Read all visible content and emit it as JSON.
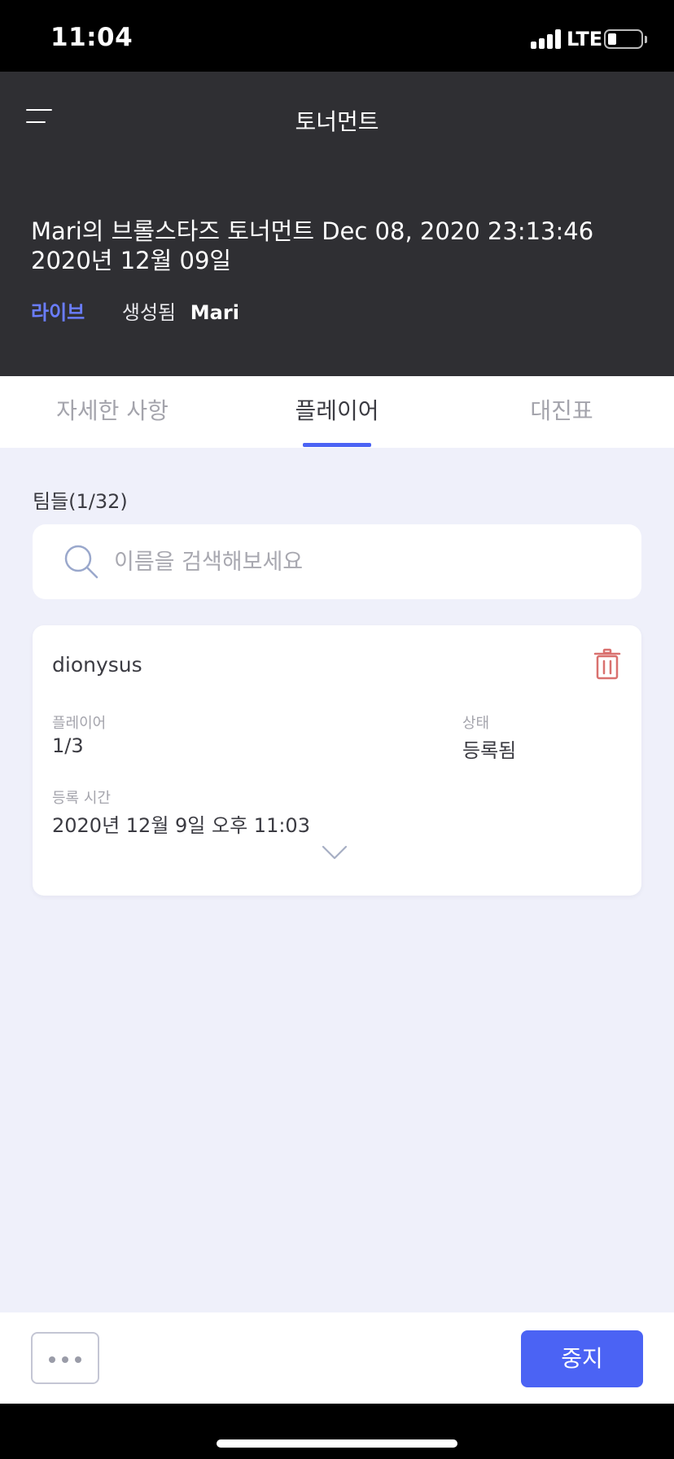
{
  "status_bar": {
    "time": "11:04",
    "network": "LTE"
  },
  "header": {
    "title": "토너먼트",
    "tournament_name": "Mari의 브롤스타즈 토너먼트 Dec 08, 2020 23:13:46 2020년 12월 09일",
    "live_label": "라이브",
    "created_label": "생성됨",
    "creator": "Mari"
  },
  "tabs": [
    {
      "label": "자세한 사항"
    },
    {
      "label": "플레이어",
      "active": true
    },
    {
      "label": "대진표"
    }
  ],
  "teams": {
    "label": "팀들(1/32)",
    "search_placeholder": "이름을 검색해보세요",
    "search_value": ""
  },
  "team_card": {
    "name": "dionysus",
    "players_label": "플레이어",
    "players_value": "1/3",
    "status_label": "상태",
    "status_value": "등록됨",
    "registered_label": "등록 시간",
    "registered_value": "2020년 12월 9일 오후 11:03"
  },
  "bottom_bar": {
    "stop_label": "중지"
  },
  "colors": {
    "accent": "#4b63f4",
    "live": "#6a7dff",
    "header_bg": "#2f2f33",
    "page_bg": "#eff0fa",
    "delete": "#d9716f"
  },
  "icons": {
    "menu": "menu-icon",
    "search": "search-icon",
    "trash": "trash-icon",
    "expand": "chevron-down-icon",
    "more": "more-icon"
  }
}
